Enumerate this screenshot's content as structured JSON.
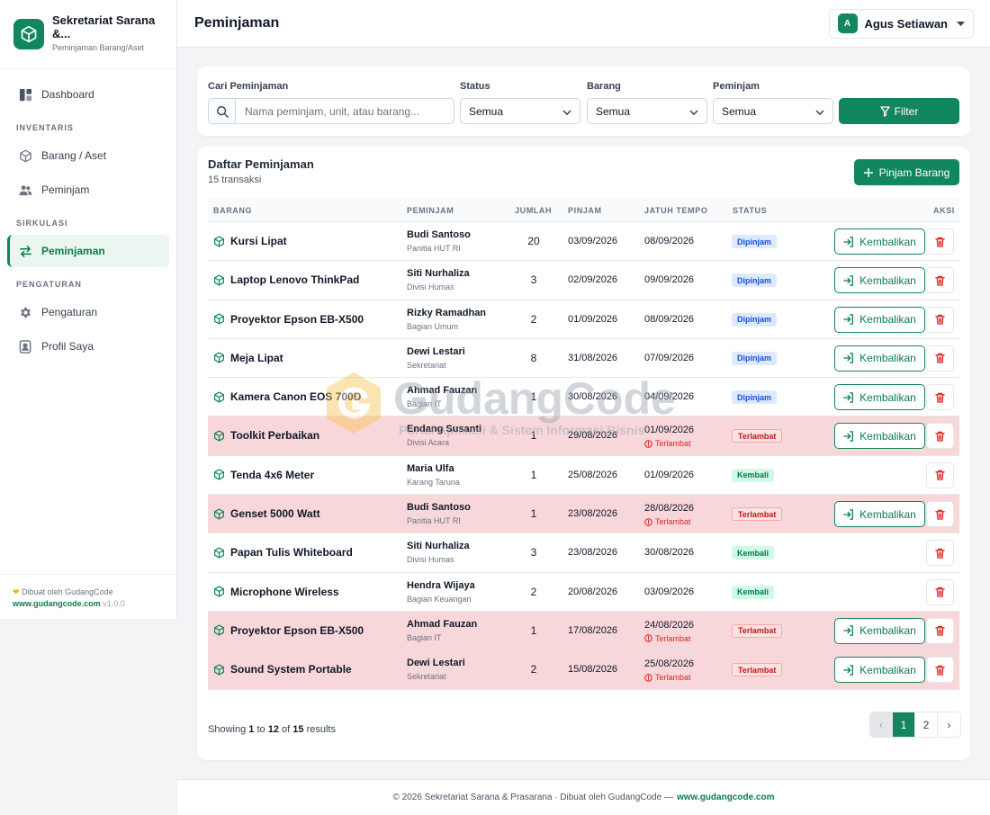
{
  "sidebar": {
    "brand_title": "Sekretariat Sarana &...",
    "brand_subtitle": "Peminjaman Barang/Aset",
    "dashboard": "Dashboard",
    "section_inventaris": "INVENTARIS",
    "barang": "Barang / Aset",
    "peminjam": "Peminjam",
    "section_sirkulasi": "SIRKULASI",
    "peminjaman": "Peminjaman",
    "section_pengaturan": "PENGATURAN",
    "pengaturan": "Pengaturan",
    "profil": "Profil Saya",
    "footer_made": "Dibuat oleh GudangCode",
    "footer_url": "www.gudangcode.com",
    "footer_version": "v1.0.0"
  },
  "header": {
    "title": "Peminjaman",
    "user_initial": "A",
    "user_name": "Agus Setiawan"
  },
  "filters": {
    "search_label": "Cari Peminjaman",
    "search_placeholder": "Nama peminjam, unit, atau barang...",
    "status_label": "Status",
    "status_value": "Semua",
    "barang_label": "Barang",
    "barang_value": "Semua",
    "peminjam_label": "Peminjam",
    "peminjam_value": "Semua",
    "filter_button": "Filter"
  },
  "list": {
    "title": "Daftar Peminjaman",
    "count": "15 transaksi",
    "add_button": "Pinjam Barang",
    "columns": {
      "barang": "BARANG",
      "peminjam": "PEMINJAM",
      "jumlah": "JUMLAH",
      "pinjam": "PINJAM",
      "jatuh_tempo": "JATUH TEMPO",
      "status": "STATUS",
      "aksi": "AKSI"
    },
    "return_label": "Kembalikan",
    "late_note": "Terlambat",
    "rows": [
      {
        "item": "Kursi Lipat",
        "name": "Budi Santoso",
        "unit": "Panitia HUT RI",
        "qty": "20",
        "pinjam": "03/09/2026",
        "due": "08/09/2026",
        "status": "Dipinjam",
        "kind": "dipinjam"
      },
      {
        "item": "Laptop Lenovo ThinkPad",
        "name": "Siti Nurhaliza",
        "unit": "Divisi Humas",
        "qty": "3",
        "pinjam": "02/09/2026",
        "due": "09/09/2026",
        "status": "Dipinjam",
        "kind": "dipinjam"
      },
      {
        "item": "Proyektor Epson EB-X500",
        "name": "Rizky Ramadhan",
        "unit": "Bagian Umum",
        "qty": "2",
        "pinjam": "01/09/2026",
        "due": "08/09/2026",
        "status": "Dipinjam",
        "kind": "dipinjam"
      },
      {
        "item": "Meja Lipat",
        "name": "Dewi Lestari",
        "unit": "Sekretariat",
        "qty": "8",
        "pinjam": "31/08/2026",
        "due": "07/09/2026",
        "status": "Dipinjam",
        "kind": "dipinjam"
      },
      {
        "item": "Kamera Canon EOS 700D",
        "name": "Ahmad Fauzan",
        "unit": "Bagian IT",
        "qty": "1",
        "pinjam": "30/08/2026",
        "due": "04/09/2026",
        "status": "Dipinjam",
        "kind": "dipinjam"
      },
      {
        "item": "Toolkit Perbaikan",
        "name": "Endang Susanti",
        "unit": "Divisi Acara",
        "qty": "1",
        "pinjam": "29/08/2026",
        "due": "01/09/2026",
        "status": "Terlambat",
        "kind": "terlambat"
      },
      {
        "item": "Tenda 4x6 Meter",
        "name": "Maria Ulfa",
        "unit": "Karang Taruna",
        "qty": "1",
        "pinjam": "25/08/2026",
        "due": "01/09/2026",
        "status": "Kembali",
        "kind": "kembali"
      },
      {
        "item": "Genset 5000 Watt",
        "name": "Budi Santoso",
        "unit": "Panitia HUT RI",
        "qty": "1",
        "pinjam": "23/08/2026",
        "due": "28/08/2026",
        "status": "Terlambat",
        "kind": "terlambat"
      },
      {
        "item": "Papan Tulis Whiteboard",
        "name": "Siti Nurhaliza",
        "unit": "Divisi Humas",
        "qty": "3",
        "pinjam": "23/08/2026",
        "due": "30/08/2026",
        "status": "Kembali",
        "kind": "kembali"
      },
      {
        "item": "Microphone Wireless",
        "name": "Hendra Wijaya",
        "unit": "Bagian Keuangan",
        "qty": "2",
        "pinjam": "20/08/2026",
        "due": "03/09/2026",
        "status": "Kembali",
        "kind": "kembali"
      },
      {
        "item": "Proyektor Epson EB-X500",
        "name": "Ahmad Fauzan",
        "unit": "Bagian IT",
        "qty": "1",
        "pinjam": "17/08/2026",
        "due": "24/08/2026",
        "status": "Terlambat",
        "kind": "terlambat"
      },
      {
        "item": "Sound System Portable",
        "name": "Dewi Lestari",
        "unit": "Sekretariat",
        "qty": "2",
        "pinjam": "15/08/2026",
        "due": "25/08/2026",
        "status": "Terlambat",
        "kind": "terlambat"
      }
    ],
    "showing_prefix": "Showing",
    "showing_from": "1",
    "showing_to_word": "to",
    "showing_to": "12",
    "showing_of_word": "of",
    "showing_total": "15",
    "showing_suffix": "results",
    "pager": {
      "prev": "‹",
      "pages": [
        "1",
        "2"
      ],
      "next": "›"
    }
  },
  "footer": {
    "text": "© 2026 Sekretariat Sarana & Prasarana · Dibuat oleh GudangCode —",
    "url": "www.gudangcode.com"
  },
  "watermark": {
    "name": "GudangCode",
    "tagline": "Portal Aplikasi & Sistem Informasi Bisnis"
  },
  "colors": {
    "brand": "#12865c",
    "late_row": "#f8d7da",
    "dipinjam_badge": "#dbeafe",
    "terlambat_badge": "#fee2e2",
    "kembali_badge": "#d1fae5"
  }
}
